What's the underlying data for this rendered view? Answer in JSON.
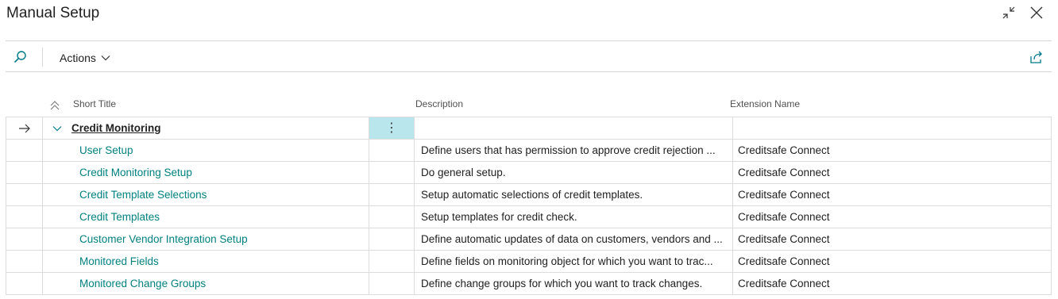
{
  "window": {
    "title": "Manual Setup"
  },
  "toolbar": {
    "actions_label": "Actions"
  },
  "columns": {
    "short_title": "Short Title",
    "description": "Description",
    "extension_name": "Extension Name"
  },
  "group": {
    "title": "Credit Monitoring"
  },
  "rows": [
    {
      "title": "User Setup",
      "description": "Define users that has permission to approve credit rejection ...",
      "extension": "Creditsafe Connect"
    },
    {
      "title": "Credit Monitoring Setup",
      "description": "Do general setup.",
      "extension": "Creditsafe Connect"
    },
    {
      "title": "Credit Template Selections",
      "description": "Setup automatic selections of credit templates.",
      "extension": "Creditsafe Connect"
    },
    {
      "title": "Credit Templates",
      "description": "Setup templates for credit check.",
      "extension": "Creditsafe Connect"
    },
    {
      "title": "Customer Vendor Integration Setup",
      "description": "Define automatic updates of data on customers, vendors and ...",
      "extension": "Creditsafe Connect"
    },
    {
      "title": "Monitored Fields",
      "description": "Define fields on monitoring object for which you want to trac...",
      "extension": "Creditsafe Connect"
    },
    {
      "title": "Monitored Change Groups",
      "description": "Define change groups for which you want to track changes.",
      "extension": "Creditsafe Connect"
    }
  ],
  "colors": {
    "link": "#00807f",
    "selected_cell": "#b8e6ec",
    "accent": "#007a8a"
  }
}
